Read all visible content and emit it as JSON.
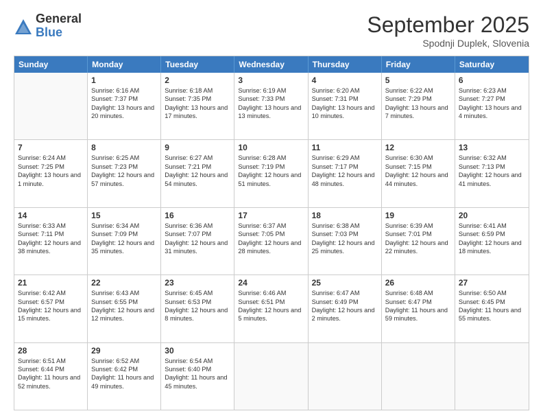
{
  "logo": {
    "general": "General",
    "blue": "Blue"
  },
  "header": {
    "month": "September 2025",
    "location": "Spodnji Duplek, Slovenia"
  },
  "weekdays": [
    "Sunday",
    "Monday",
    "Tuesday",
    "Wednesday",
    "Thursday",
    "Friday",
    "Saturday"
  ],
  "weeks": [
    [
      {
        "day": "",
        "sunrise": "",
        "sunset": "",
        "daylight": ""
      },
      {
        "day": "1",
        "sunrise": "Sunrise: 6:16 AM",
        "sunset": "Sunset: 7:37 PM",
        "daylight": "Daylight: 13 hours and 20 minutes."
      },
      {
        "day": "2",
        "sunrise": "Sunrise: 6:18 AM",
        "sunset": "Sunset: 7:35 PM",
        "daylight": "Daylight: 13 hours and 17 minutes."
      },
      {
        "day": "3",
        "sunrise": "Sunrise: 6:19 AM",
        "sunset": "Sunset: 7:33 PM",
        "daylight": "Daylight: 13 hours and 13 minutes."
      },
      {
        "day": "4",
        "sunrise": "Sunrise: 6:20 AM",
        "sunset": "Sunset: 7:31 PM",
        "daylight": "Daylight: 13 hours and 10 minutes."
      },
      {
        "day": "5",
        "sunrise": "Sunrise: 6:22 AM",
        "sunset": "Sunset: 7:29 PM",
        "daylight": "Daylight: 13 hours and 7 minutes."
      },
      {
        "day": "6",
        "sunrise": "Sunrise: 6:23 AM",
        "sunset": "Sunset: 7:27 PM",
        "daylight": "Daylight: 13 hours and 4 minutes."
      }
    ],
    [
      {
        "day": "7",
        "sunrise": "Sunrise: 6:24 AM",
        "sunset": "Sunset: 7:25 PM",
        "daylight": "Daylight: 13 hours and 1 minute."
      },
      {
        "day": "8",
        "sunrise": "Sunrise: 6:25 AM",
        "sunset": "Sunset: 7:23 PM",
        "daylight": "Daylight: 12 hours and 57 minutes."
      },
      {
        "day": "9",
        "sunrise": "Sunrise: 6:27 AM",
        "sunset": "Sunset: 7:21 PM",
        "daylight": "Daylight: 12 hours and 54 minutes."
      },
      {
        "day": "10",
        "sunrise": "Sunrise: 6:28 AM",
        "sunset": "Sunset: 7:19 PM",
        "daylight": "Daylight: 12 hours and 51 minutes."
      },
      {
        "day": "11",
        "sunrise": "Sunrise: 6:29 AM",
        "sunset": "Sunset: 7:17 PM",
        "daylight": "Daylight: 12 hours and 48 minutes."
      },
      {
        "day": "12",
        "sunrise": "Sunrise: 6:30 AM",
        "sunset": "Sunset: 7:15 PM",
        "daylight": "Daylight: 12 hours and 44 minutes."
      },
      {
        "day": "13",
        "sunrise": "Sunrise: 6:32 AM",
        "sunset": "Sunset: 7:13 PM",
        "daylight": "Daylight: 12 hours and 41 minutes."
      }
    ],
    [
      {
        "day": "14",
        "sunrise": "Sunrise: 6:33 AM",
        "sunset": "Sunset: 7:11 PM",
        "daylight": "Daylight: 12 hours and 38 minutes."
      },
      {
        "day": "15",
        "sunrise": "Sunrise: 6:34 AM",
        "sunset": "Sunset: 7:09 PM",
        "daylight": "Daylight: 12 hours and 35 minutes."
      },
      {
        "day": "16",
        "sunrise": "Sunrise: 6:36 AM",
        "sunset": "Sunset: 7:07 PM",
        "daylight": "Daylight: 12 hours and 31 minutes."
      },
      {
        "day": "17",
        "sunrise": "Sunrise: 6:37 AM",
        "sunset": "Sunset: 7:05 PM",
        "daylight": "Daylight: 12 hours and 28 minutes."
      },
      {
        "day": "18",
        "sunrise": "Sunrise: 6:38 AM",
        "sunset": "Sunset: 7:03 PM",
        "daylight": "Daylight: 12 hours and 25 minutes."
      },
      {
        "day": "19",
        "sunrise": "Sunrise: 6:39 AM",
        "sunset": "Sunset: 7:01 PM",
        "daylight": "Daylight: 12 hours and 22 minutes."
      },
      {
        "day": "20",
        "sunrise": "Sunrise: 6:41 AM",
        "sunset": "Sunset: 6:59 PM",
        "daylight": "Daylight: 12 hours and 18 minutes."
      }
    ],
    [
      {
        "day": "21",
        "sunrise": "Sunrise: 6:42 AM",
        "sunset": "Sunset: 6:57 PM",
        "daylight": "Daylight: 12 hours and 15 minutes."
      },
      {
        "day": "22",
        "sunrise": "Sunrise: 6:43 AM",
        "sunset": "Sunset: 6:55 PM",
        "daylight": "Daylight: 12 hours and 12 minutes."
      },
      {
        "day": "23",
        "sunrise": "Sunrise: 6:45 AM",
        "sunset": "Sunset: 6:53 PM",
        "daylight": "Daylight: 12 hours and 8 minutes."
      },
      {
        "day": "24",
        "sunrise": "Sunrise: 6:46 AM",
        "sunset": "Sunset: 6:51 PM",
        "daylight": "Daylight: 12 hours and 5 minutes."
      },
      {
        "day": "25",
        "sunrise": "Sunrise: 6:47 AM",
        "sunset": "Sunset: 6:49 PM",
        "daylight": "Daylight: 12 hours and 2 minutes."
      },
      {
        "day": "26",
        "sunrise": "Sunrise: 6:48 AM",
        "sunset": "Sunset: 6:47 PM",
        "daylight": "Daylight: 11 hours and 59 minutes."
      },
      {
        "day": "27",
        "sunrise": "Sunrise: 6:50 AM",
        "sunset": "Sunset: 6:45 PM",
        "daylight": "Daylight: 11 hours and 55 minutes."
      }
    ],
    [
      {
        "day": "28",
        "sunrise": "Sunrise: 6:51 AM",
        "sunset": "Sunset: 6:44 PM",
        "daylight": "Daylight: 11 hours and 52 minutes."
      },
      {
        "day": "29",
        "sunrise": "Sunrise: 6:52 AM",
        "sunset": "Sunset: 6:42 PM",
        "daylight": "Daylight: 11 hours and 49 minutes."
      },
      {
        "day": "30",
        "sunrise": "Sunrise: 6:54 AM",
        "sunset": "Sunset: 6:40 PM",
        "daylight": "Daylight: 11 hours and 45 minutes."
      },
      {
        "day": "",
        "sunrise": "",
        "sunset": "",
        "daylight": ""
      },
      {
        "day": "",
        "sunrise": "",
        "sunset": "",
        "daylight": ""
      },
      {
        "day": "",
        "sunrise": "",
        "sunset": "",
        "daylight": ""
      },
      {
        "day": "",
        "sunrise": "",
        "sunset": "",
        "daylight": ""
      }
    ]
  ]
}
